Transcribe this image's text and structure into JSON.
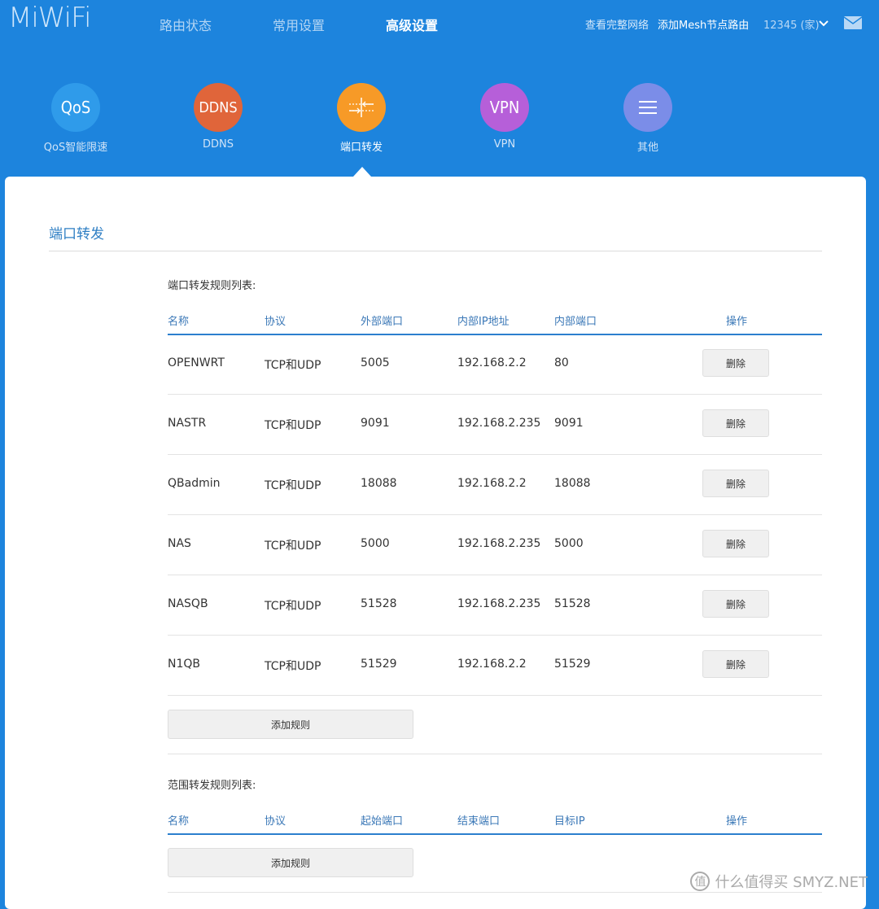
{
  "header": {
    "logo": "MiWiFi",
    "nav": [
      "路由状态",
      "常用设置",
      "高级设置"
    ],
    "active_nav": "高级设置",
    "view_network": "查看完整网络",
    "add_mesh": "添加Mesh节点路由",
    "router_name": "12345 (家)"
  },
  "features": [
    {
      "icon_text": "QoS",
      "label": "QoS智能限速",
      "color": "#2f9bea"
    },
    {
      "icon_text": "DDNS",
      "label": "DDNS",
      "color": "#e0653a"
    },
    {
      "icon_text": "",
      "icon": "port-forward-icon",
      "label": "端口转发",
      "color": "#f79a27"
    },
    {
      "icon_text": "VPN",
      "label": "VPN",
      "color": "#b65fd9"
    },
    {
      "icon_text": "",
      "icon": "menu-icon",
      "label": "其他",
      "color": "#7b8de8"
    }
  ],
  "panel": {
    "title": "端口转发",
    "port_rules": {
      "title": "端口转发规则列表:",
      "columns": [
        "名称",
        "协议",
        "外部端口",
        "内部IP地址",
        "内部端口",
        "操作"
      ],
      "rows": [
        {
          "name": "OPENWRT",
          "protocol": "TCP和UDP",
          "ext_port": "5005",
          "ip": "192.168.2.2",
          "int_port": "80"
        },
        {
          "name": "NASTR",
          "protocol": "TCP和UDP",
          "ext_port": "9091",
          "ip": "192.168.2.235",
          "int_port": "9091"
        },
        {
          "name": "QBadmin",
          "protocol": "TCP和UDP",
          "ext_port": "18088",
          "ip": "192.168.2.2",
          "int_port": "18088"
        },
        {
          "name": "NAS",
          "protocol": "TCP和UDP",
          "ext_port": "5000",
          "ip": "192.168.2.235",
          "int_port": "5000"
        },
        {
          "name": "NASQB",
          "protocol": "TCP和UDP",
          "ext_port": "51528",
          "ip": "192.168.2.235",
          "int_port": "51528"
        },
        {
          "name": "N1QB",
          "protocol": "TCP和UDP",
          "ext_port": "51529",
          "ip": "192.168.2.2",
          "int_port": "51529"
        }
      ],
      "delete_label": "删除",
      "add_label": "添加规则"
    },
    "range_rules": {
      "title": "范围转发规则列表:",
      "columns": [
        "名称",
        "协议",
        "起始端口",
        "结束端口",
        "目标IP",
        "操作"
      ],
      "add_label": "添加规则"
    }
  },
  "watermark": "什么值得买 SMYZ.NET"
}
